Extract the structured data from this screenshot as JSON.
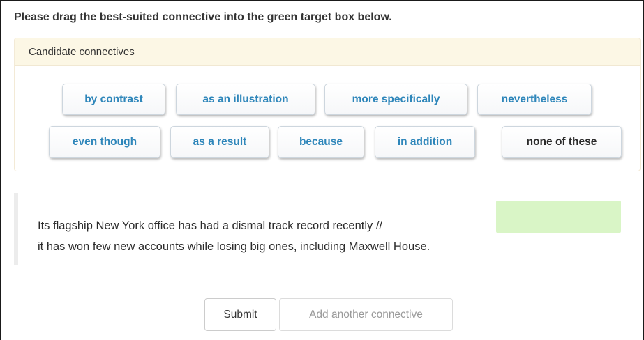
{
  "instruction": "Please drag the best-suited connective into the green target box below.",
  "candidates_panel": {
    "heading": "Candidate connectives",
    "row1": [
      "by contrast",
      "as an illustration",
      "more specifically",
      "nevertheless"
    ],
    "row2": [
      "even though",
      "as a result",
      "because",
      "in addition",
      "none of these"
    ]
  },
  "sentence": {
    "line1": "Its flagship New York office has had a dismal track record recently //",
    "line2": "it has won few new accounts while losing big ones, including Maxwell House."
  },
  "buttons": {
    "submit": "Submit",
    "add_another": "Add another connective"
  },
  "colors": {
    "connective_text": "#2e86ba",
    "panel_heading_bg": "#fcf7e5",
    "drop_target": "#d9f5c6"
  }
}
